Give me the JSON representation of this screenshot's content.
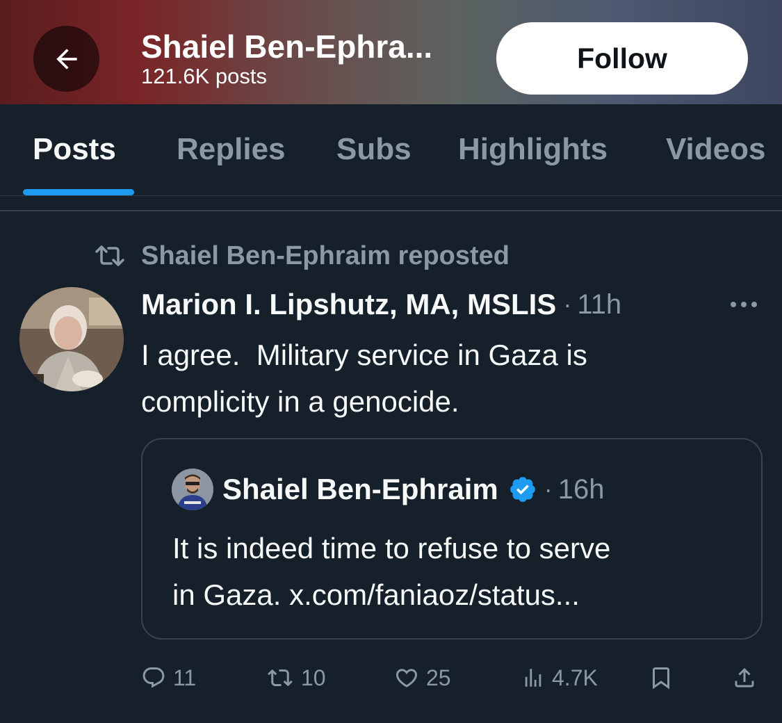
{
  "header": {
    "title": "Shaiel Ben-Ephra...",
    "post_count": "121.6K posts",
    "follow_label": "Follow"
  },
  "tabs": [
    {
      "label": "Posts",
      "active": true
    },
    {
      "label": "Replies",
      "active": false
    },
    {
      "label": "Subs",
      "active": false
    },
    {
      "label": "Highlights",
      "active": false
    },
    {
      "label": "Videos",
      "active": false
    }
  ],
  "post": {
    "repost_label": "Shaiel Ben-Ephraim reposted",
    "author_name": "Marion I. Lipshutz, MA, MSLIS",
    "time": "11h",
    "text_line1": "I agree.  Military service in Gaza is",
    "text_line2": "complicity in a genocide.",
    "quote": {
      "author_name": "Shaiel Ben-Ephraim",
      "verified": true,
      "time": "16h",
      "text_line1": "It is indeed time to refuse to serve",
      "text_line2": "in Gaza. x.com/faniaoz/status..."
    },
    "stats": {
      "replies": "11",
      "reposts": "10",
      "likes": "25",
      "views": "4.7K"
    }
  },
  "colors": {
    "background": "#15202b",
    "accent": "#1d9bf0",
    "muted": "#8b98a5",
    "border": "#38444d"
  },
  "icons": [
    "back-arrow-icon",
    "repost-icon",
    "more-icon",
    "verified-icon",
    "reply-icon",
    "repost-icon",
    "like-icon",
    "views-icon",
    "bookmark-icon",
    "share-icon"
  ]
}
